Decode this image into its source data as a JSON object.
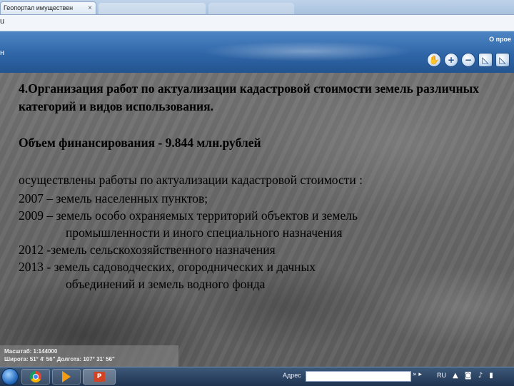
{
  "browser": {
    "tab_title": "Геопортал имуществен",
    "tab_close": "×",
    "address_fragment": "u"
  },
  "site_header": {
    "left_fragment": "н",
    "about_link": "О прое",
    "tools": [
      {
        "icon": "hand-icon",
        "glyph": "✋"
      },
      {
        "icon": "zoom-in-icon",
        "glyph": "+"
      },
      {
        "icon": "zoom-out-icon",
        "glyph": "−"
      },
      {
        "icon": "measure-icon",
        "glyph": "◺"
      },
      {
        "icon": "measure-area-icon",
        "glyph": "◺"
      }
    ]
  },
  "slide": {
    "heading": "4.Организация работ по актуализации кадастровой стоимости земель различных категорий и видов использования.",
    "finance": "Объем финансирования - 9.844 млн.рублей",
    "intro": "осуществлены работы по актуализации кадастровой стоимости :",
    "items": [
      {
        "line": "2007 – земель населенных пунктов;",
        "cont": ""
      },
      {
        "line": "2009 – земель особо охраняемых территорий объектов и земель",
        "cont": "промышленности и иного специального назначения"
      },
      {
        "line": "2012 -земель сельскохозяйственного назначения",
        "cont": ""
      },
      {
        "line": "2013 - земель садоводческих, огороднических и дачных",
        "cont": "объединений и земель водного фонда"
      }
    ]
  },
  "status_bar": {
    "scale": "Масштаб: 1:144000",
    "coords": "Широта: 51° 4' 56\" Долгота: 107° 31' 56\""
  },
  "taskbar": {
    "address_label": "Адрес",
    "arrows": "» ▸",
    "language": "RU",
    "tray_icons": "▲ ◙ ♪ ▮"
  }
}
